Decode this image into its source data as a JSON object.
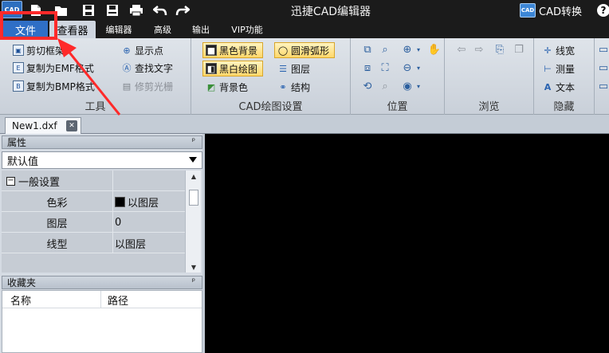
{
  "titlebar": {
    "app_logo": "CAD",
    "title": "迅捷CAD编辑器",
    "convert_badge": "CAD",
    "convert_label": "CAD转换",
    "help": "?"
  },
  "quick_access": {
    "icons": [
      "new-file-icon",
      "open-folder-icon",
      "save-icon",
      "save-as-icon",
      "print-icon",
      "undo-icon",
      "redo-icon"
    ]
  },
  "tabs": {
    "file": "文件",
    "viewer": "查看器",
    "editor": "编辑器",
    "advanced": "高级",
    "output": "输出",
    "vip": "VIP功能"
  },
  "ribbon": {
    "tools": {
      "label": "工具",
      "clip_frame": "剪切框架",
      "copy_emf": "复制为EMF格式",
      "copy_bmp": "复制为BMP格式",
      "show_point": "显示点",
      "find_text": "查找文字",
      "trim_raster": "修剪光栅"
    },
    "drawing": {
      "label": "CAD绘图设置",
      "black_bg": "黑色背景",
      "bw_drawing": "黑白绘图",
      "bg_color": "背景色",
      "smooth_arc": "圆滑弧形",
      "layers": "图层",
      "structure": "结构"
    },
    "position": {
      "label": "位置"
    },
    "browse": {
      "label": "浏览"
    },
    "hide": {
      "label": "隐藏",
      "line_width": "线宽",
      "measure": "测量",
      "text": "文本"
    }
  },
  "document": {
    "tab_name": "New1.dxf",
    "close": "✕"
  },
  "properties": {
    "title": "属性",
    "pin": "ᵖ",
    "dropdown_value": "默认值",
    "section": "一般设置",
    "expander": "−",
    "rows": [
      {
        "label": "色彩",
        "value": "以图层"
      },
      {
        "label": "图层",
        "value": "0"
      },
      {
        "label": "线型",
        "value": "以图层"
      }
    ]
  },
  "favorites": {
    "title": "收藏夹",
    "pin": "ᵖ",
    "col_name": "名称",
    "col_path": "路径"
  },
  "colors": {
    "accent_file_tab": "#2f6fc6",
    "highlight": "#ff2a2a",
    "canvas": "#000000"
  }
}
